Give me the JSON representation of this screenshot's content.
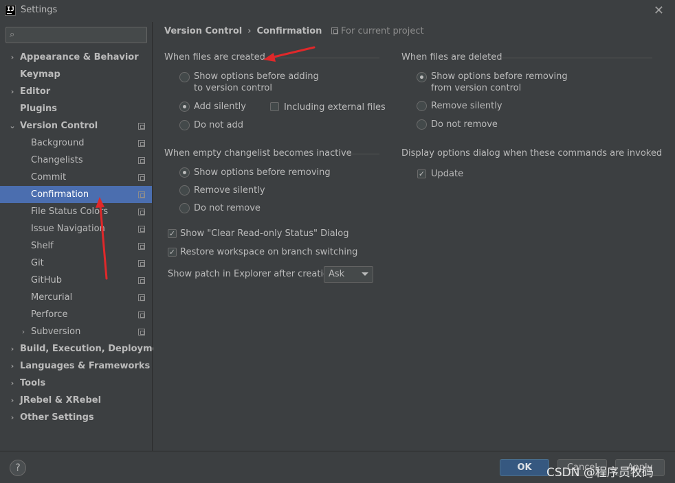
{
  "window": {
    "title": "Settings"
  },
  "search": {
    "placeholder": "",
    "value": ""
  },
  "sidebar": {
    "items": [
      {
        "label": "Appearance & Behavior"
      },
      {
        "label": "Keymap"
      },
      {
        "label": "Editor"
      },
      {
        "label": "Plugins"
      },
      {
        "label": "Version Control"
      },
      {
        "label": "Background"
      },
      {
        "label": "Changelists"
      },
      {
        "label": "Commit"
      },
      {
        "label": "Confirmation"
      },
      {
        "label": "File Status Colors"
      },
      {
        "label": "Issue Navigation"
      },
      {
        "label": "Shelf"
      },
      {
        "label": "Git"
      },
      {
        "label": "GitHub"
      },
      {
        "label": "Mercurial"
      },
      {
        "label": "Perforce"
      },
      {
        "label": "Subversion"
      },
      {
        "label": "Build, Execution, Deployment"
      },
      {
        "label": "Languages & Frameworks"
      },
      {
        "label": "Tools"
      },
      {
        "label": "JRebel & XRebel"
      },
      {
        "label": "Other Settings"
      }
    ]
  },
  "breadcrumb": {
    "parent": "Version Control",
    "separator": "›",
    "current": "Confirmation",
    "scope": "For current project"
  },
  "created": {
    "title": "When files are created",
    "opt1_line1": "Show options before adding",
    "opt1_line2": "to version control",
    "opt2": "Add silently",
    "opt3": "Do not add",
    "including": "Including external files"
  },
  "deleted": {
    "title": "When files are deleted",
    "opt1_line1": "Show options before removing",
    "opt1_line2": "from version control",
    "opt2": "Remove silently",
    "opt3": "Do not remove"
  },
  "changelist": {
    "title": "When empty changelist becomes inactive",
    "opt1": "Show options before removing",
    "opt2": "Remove silently",
    "opt3": "Do not remove"
  },
  "commands": {
    "title": "Display options dialog when these commands are invoked",
    "update": "Update"
  },
  "checks": {
    "clear_readonly": "Show \"Clear Read-only Status\" Dialog",
    "restore_workspace": "Restore workspace on branch switching"
  },
  "patch": {
    "label": "Show patch in Explorer after creation:",
    "value": "Ask"
  },
  "footer": {
    "help": "?",
    "ok": "OK",
    "cancel": "Cancel",
    "apply": "Apply",
    "watermark": "CSDN @程序员牧码"
  },
  "colors": {
    "background": "#3c3f41",
    "selection": "#4b6eaf",
    "ok_button": "#365880",
    "annotation_arrow": "#e0282a"
  }
}
